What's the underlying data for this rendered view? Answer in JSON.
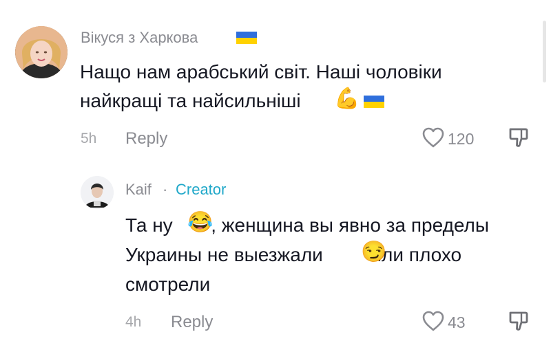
{
  "comments": [
    {
      "username": "Вікуся з Харкова",
      "text_line1": "Нащо нам арабський світ. Наші чоловіки",
      "text_line2": "найкращі та найсильніші",
      "time": "5h",
      "reply_label": "Reply",
      "like_count": "120",
      "flag_colors": [
        "#2f6fdc",
        "#ffd200"
      ],
      "emoji": "💪"
    },
    {
      "username": "Kaif",
      "separator": "·",
      "badge": "Creator",
      "text_part1": "Та ну",
      "text_part2": ", женщина вы явно за пределы",
      "text_line2a": "Украины не выезжали",
      "text_line2b": "или плохо",
      "text_line3": "смотрели",
      "emoji1": "😂",
      "emoji2": "😏",
      "time": "4h",
      "reply_label": "Reply",
      "like_count": "43"
    }
  ],
  "icons": {
    "like": "heart-outline-icon",
    "dislike": "thumbs-down-icon"
  },
  "colors": {
    "creator_accent": "#20a8c9",
    "muted_text": "#8a8b91"
  }
}
